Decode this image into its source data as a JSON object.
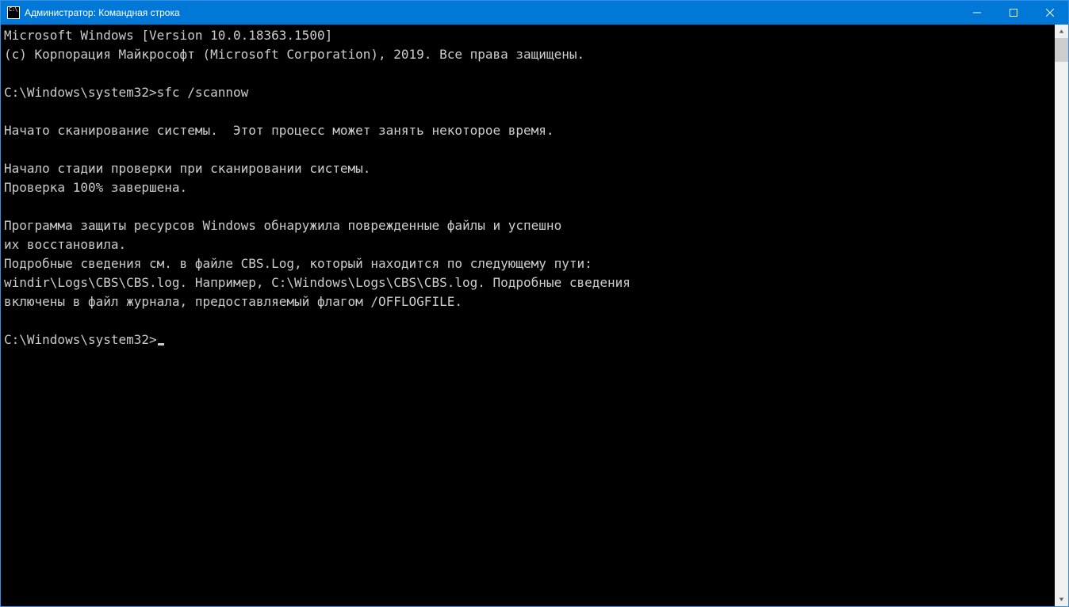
{
  "titlebar": {
    "title": "Администратор: Командная строка"
  },
  "console": {
    "lines": [
      "Microsoft Windows [Version 10.0.18363.1500]",
      "(c) Корпорация Майкрософт (Microsoft Corporation), 2019. Все права защищены.",
      "",
      "C:\\Windows\\system32>sfc /scannow",
      "",
      "Начато сканирование системы.  Этот процесс может занять некоторое время.",
      "",
      "Начало стадии проверки при сканировании системы.",
      "Проверка 100% завершена.",
      "",
      "Программа защиты ресурсов Windows обнаружила поврежденные файлы и успешно",
      "их восстановила.",
      "Подробные сведения см. в файле CBS.Log, который находится по следующему пути:",
      "windir\\Logs\\CBS\\CBS.log. Например, C:\\Windows\\Logs\\CBS\\CBS.log. Подробные сведения",
      "включены в файл журнала, предоставляемый флагом /OFFLOGFILE.",
      ""
    ],
    "prompt": "C:\\Windows\\system32>"
  }
}
